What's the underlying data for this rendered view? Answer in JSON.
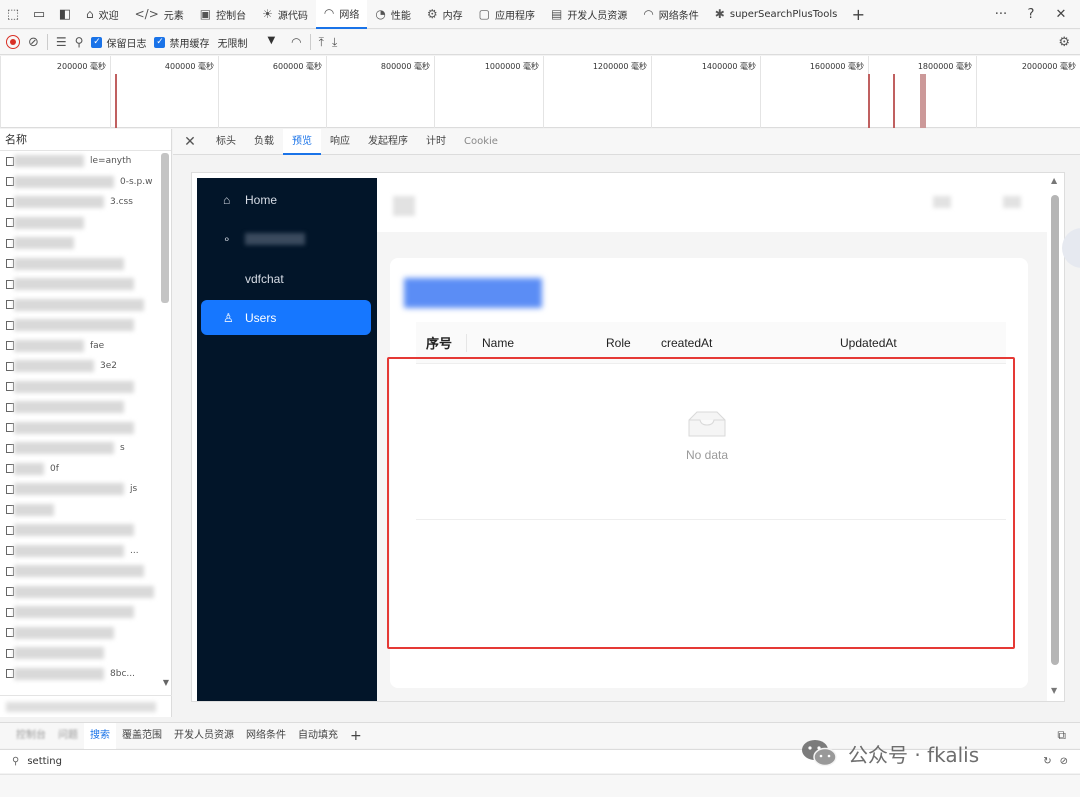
{
  "devtools": {
    "tabs": [
      {
        "label": "欢迎",
        "icon": "home-icon"
      },
      {
        "label": "元素",
        "icon": "code-icon"
      },
      {
        "label": "控制台",
        "icon": "console-icon"
      },
      {
        "label": "源代码",
        "icon": "bug-icon"
      },
      {
        "label": "网络",
        "icon": "wifi-icon"
      },
      {
        "label": "性能",
        "icon": "gauge-icon"
      },
      {
        "label": "内存",
        "icon": "memory-icon"
      },
      {
        "label": "应用程序",
        "icon": "window-icon"
      },
      {
        "label": "开发人员资源",
        "icon": "doc-icon"
      },
      {
        "label": "网络条件",
        "icon": "wifi-gear-icon"
      },
      {
        "label": "superSearchPlusTools",
        "icon": "puzzle-icon"
      }
    ],
    "active_tab": "网络",
    "add_tab": "+",
    "more": "···",
    "help": "?",
    "close": "✕"
  },
  "toolbar": {
    "preserve_log": "保留日志",
    "disable_cache": "禁用缓存",
    "throttle": "无限制"
  },
  "timeline": {
    "ticks": [
      "200000 毫秒",
      "400000 毫秒",
      "600000 毫秒",
      "800000 毫秒",
      "1000000 毫秒",
      "1200000 毫秒",
      "1400000 毫秒",
      "1600000 毫秒",
      "1800000 毫秒",
      "2000000 毫秒"
    ]
  },
  "name_panel": {
    "header": "名称",
    "rows": [
      "le=anyth",
      "0-s.p.w",
      "3.css",
      "",
      "",
      "",
      "",
      "",
      "",
      "fae",
      "3e2",
      "",
      "",
      "",
      "s",
      "0f",
      "js",
      "",
      "",
      "...",
      "",
      "",
      "",
      "",
      "",
      "8bc..."
    ]
  },
  "preview": {
    "tabs": [
      "标头",
      "负载",
      "预览",
      "响应",
      "发起程序",
      "计时",
      "Cookie"
    ],
    "active": "预览"
  },
  "app": {
    "sidebar": [
      {
        "label": "Home",
        "icon": "home-icon"
      },
      {
        "label": "",
        "icon": "network-icon"
      },
      {
        "label": "vdfchat",
        "icon": ""
      },
      {
        "label": "Users",
        "icon": "user-icon"
      }
    ],
    "table_headers": [
      "序号",
      "Name",
      "Role",
      "createdAt",
      "UpdatedAt"
    ],
    "empty_text": "No data"
  },
  "drawer": {
    "tabs": [
      "控制台",
      "问题",
      "搜索",
      "覆盖范围",
      "开发人员资源",
      "网络条件",
      "自动填充"
    ],
    "active": "搜索",
    "search_value": "setting"
  },
  "watermark": {
    "text": "公众号 · fkalis"
  }
}
